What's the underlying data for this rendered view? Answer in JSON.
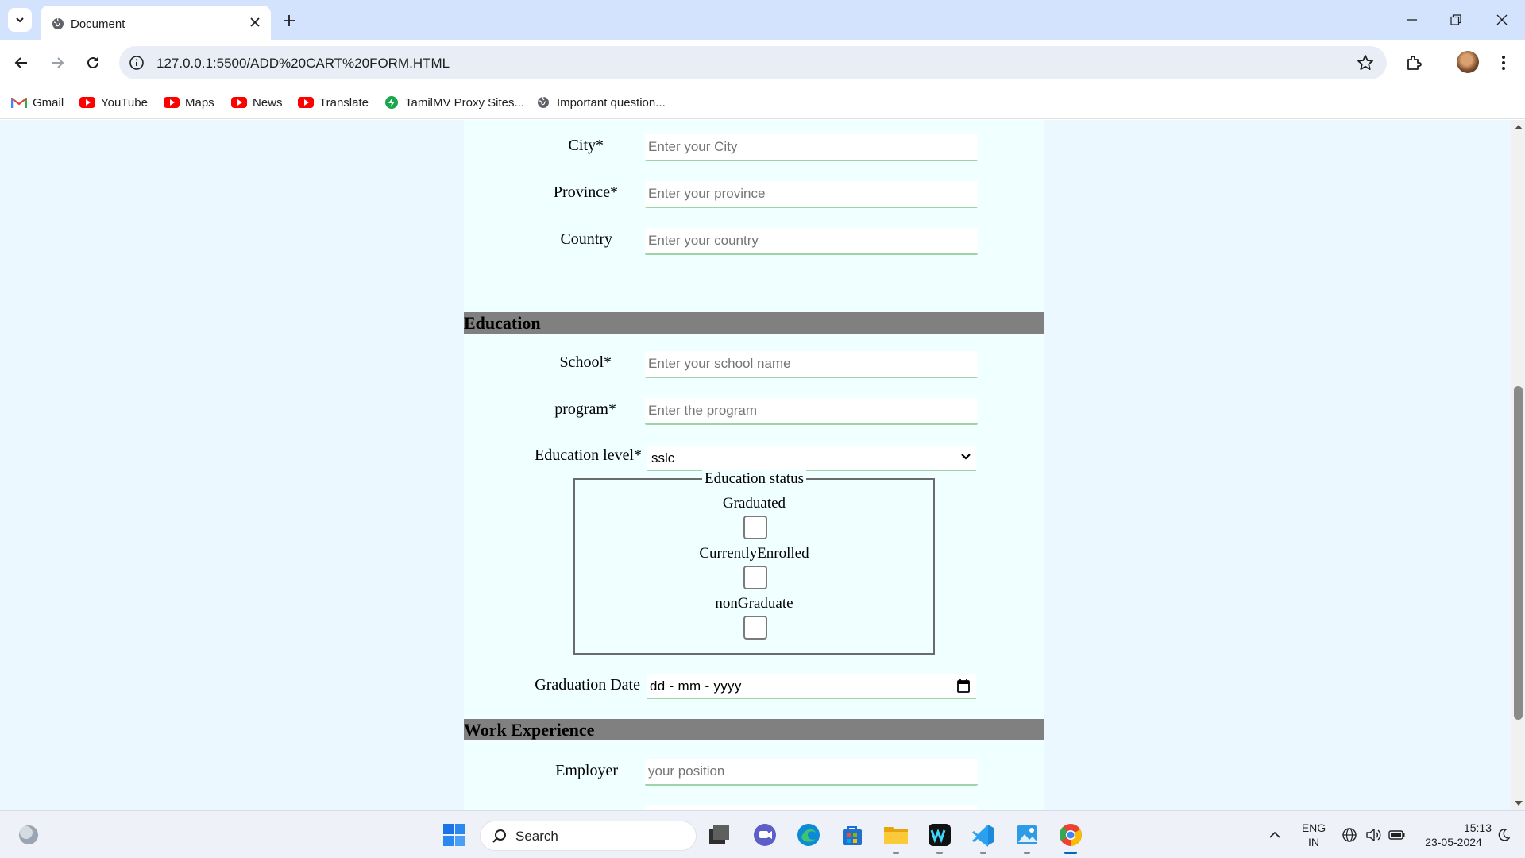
{
  "browser": {
    "tab_title": "Document",
    "url": "127.0.0.1:5500/ADD%20CART%20FORM.HTML",
    "bookmarks": [
      {
        "label": "Gmail",
        "icon": "gmail-icon"
      },
      {
        "label": "YouTube",
        "icon": "youtube-icon"
      },
      {
        "label": "Maps",
        "icon": "youtube-icon"
      },
      {
        "label": "News",
        "icon": "youtube-icon"
      },
      {
        "label": "Translate",
        "icon": "youtube-icon"
      },
      {
        "label": "TamilMV Proxy Sites...",
        "icon": "bolt-icon"
      },
      {
        "label": "Important question...",
        "icon": "globe-icon"
      }
    ]
  },
  "form": {
    "address": {
      "city_label": "City*",
      "city_placeholder": "Enter your City",
      "province_label": "Province*",
      "province_placeholder": "Enter your province",
      "country_label": "Country",
      "country_placeholder": "Enter your country"
    },
    "education": {
      "heading": "Education",
      "school_label": "School*",
      "school_placeholder": "Enter your school name",
      "program_label": "program*",
      "program_placeholder": "Enter the program",
      "level_label": "Education level*",
      "level_value": "sslc",
      "status_legend": "Education status",
      "status_options": [
        "Graduated",
        "CurrentlyEnrolled",
        "nonGraduate"
      ],
      "graduation_label": "Graduation Date",
      "graduation_value": "dd - mm - yyyy"
    },
    "work": {
      "heading": "Work Experience",
      "employer_label": "Employer",
      "employer_placeholder": "your position"
    }
  },
  "taskbar": {
    "search_label": "Search",
    "lang_top": "ENG",
    "lang_bottom": "IN",
    "time": "15:13",
    "date": "23-05-2024"
  },
  "colors": {
    "tabbar": "#d3e3fd",
    "page_bg": "#ebf8ff",
    "form_bg": "#f0ffff",
    "section_bar": "#808080",
    "input_underline": "#9ed4a6"
  }
}
